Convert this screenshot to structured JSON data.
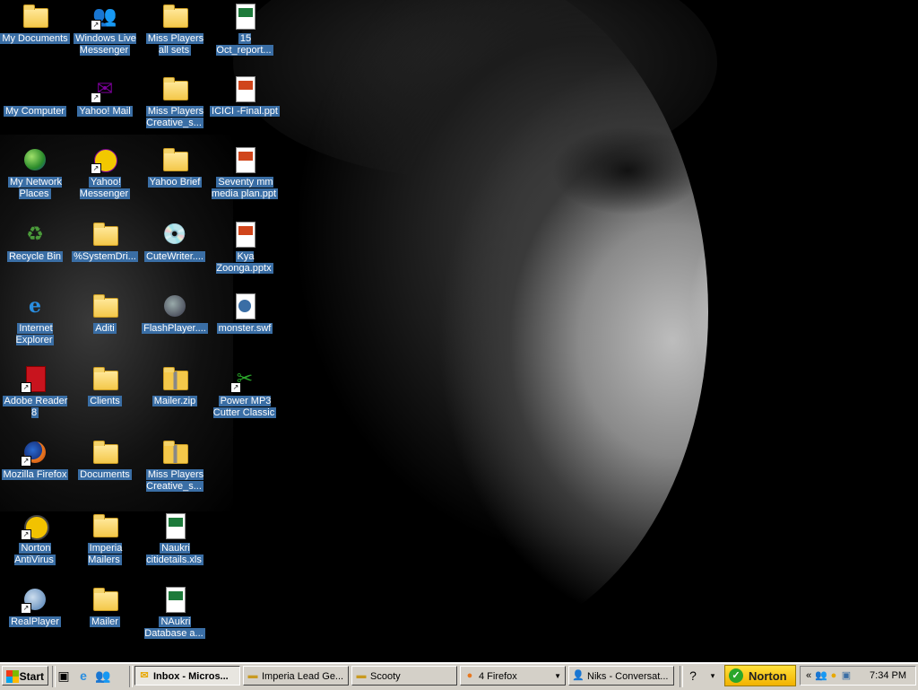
{
  "desktop": {
    "icons": [
      {
        "label": "My Documents"
      },
      {
        "label": "My Computer"
      },
      {
        "label": "My Network Places"
      },
      {
        "label": "Recycle Bin"
      },
      {
        "label": "Internet Explorer"
      },
      {
        "label": "Adobe Reader 8"
      },
      {
        "label": "Mozilla Firefox"
      },
      {
        "label": "Norton AntiVirus"
      },
      {
        "label": "RealPlayer"
      },
      {
        "label": "Windows Live Messenger"
      },
      {
        "label": "Yahoo! Mail"
      },
      {
        "label": "Yahoo! Messenger"
      },
      {
        "label": "%SystemDri..."
      },
      {
        "label": "Aditi"
      },
      {
        "label": "Clients"
      },
      {
        "label": "Documents"
      },
      {
        "label": "Imperia Mailers"
      },
      {
        "label": "Mailer"
      },
      {
        "label": "Miss Players all sets"
      },
      {
        "label": "Miss Players Creative_s..."
      },
      {
        "label": "Yahoo Brief"
      },
      {
        "label": "CuteWriter...."
      },
      {
        "label": "FlashPlayer...."
      },
      {
        "label": "Mailer.zip"
      },
      {
        "label": "Miss Players Creative_s..."
      },
      {
        "label": "Naukri citidetails.xls"
      },
      {
        "label": "NAukri Database a..."
      },
      {
        "label": "15 Oct_report..."
      },
      {
        "label": "ICICI -Final.ppt"
      },
      {
        "label": "Seventy mm media plan.ppt"
      },
      {
        "label": "Kya Zoonga.pptx"
      },
      {
        "label": "monster.swf"
      },
      {
        "label": "Power MP3 Cutter Classic"
      }
    ]
  },
  "taskbar": {
    "start_label": "Start",
    "buttons": [
      {
        "label": "Inbox - Micros..."
      },
      {
        "label": "Imperia Lead Ge..."
      },
      {
        "label": "Scooty"
      },
      {
        "label": "4 Firefox"
      },
      {
        "label": "Niks - Conversat..."
      }
    ],
    "norton_label": "Norton",
    "clock": "7:34 PM"
  },
  "colors": {
    "selection": "#3a6ea5",
    "taskbar": "#d4d0c8",
    "norton": "#f2b200"
  }
}
